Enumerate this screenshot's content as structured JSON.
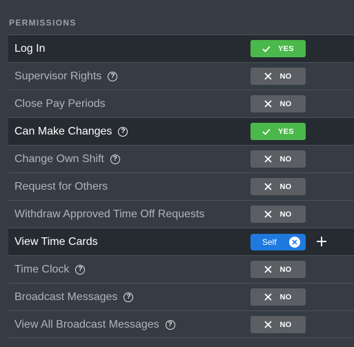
{
  "section": {
    "title": "PERMISSIONS"
  },
  "colors": {
    "yes": "#4ab84a",
    "no": "#5b5f64",
    "chip": "#1f7ae0",
    "active_row": "#262b31"
  },
  "rows": [
    {
      "label": "Log In",
      "value": "YES"
    },
    {
      "label": "Supervisor Rights",
      "value": "NO"
    },
    {
      "label": "Close Pay Periods",
      "value": "NO"
    },
    {
      "label": "Can Make Changes",
      "value": "YES"
    },
    {
      "label": "Change Own Shift",
      "value": "NO"
    },
    {
      "label": "Request for Others",
      "value": "NO"
    },
    {
      "label": "Withdraw Approved Time Off Requests",
      "value": "NO"
    },
    {
      "label": "View Time Cards",
      "value": "Self"
    },
    {
      "label": "Time Clock",
      "value": "NO"
    },
    {
      "label": "Broadcast Messages",
      "value": "NO"
    },
    {
      "label": "View All Broadcast Messages",
      "value": "NO"
    }
  ],
  "help_glyph": "?"
}
